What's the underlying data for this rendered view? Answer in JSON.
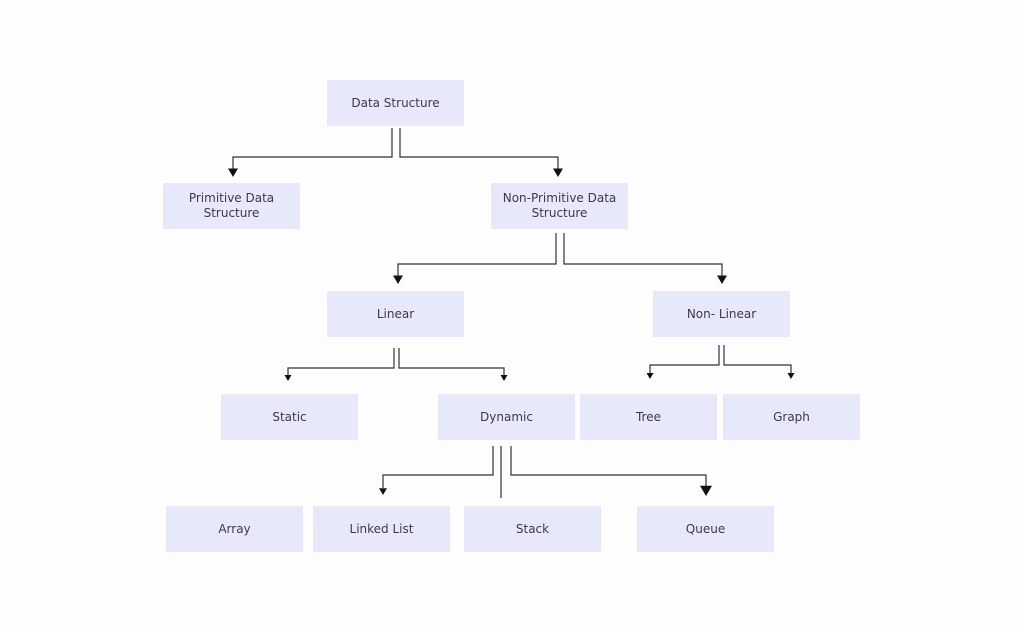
{
  "diagram": {
    "colors": {
      "node_fill": "#e8e8fb",
      "text": "#3a3a4a",
      "connector": "#333333"
    },
    "nodes": {
      "data_structure": "Data Structure",
      "primitive": "Primitive Data Structure",
      "non_primitive": "Non-Primitive Data Structure",
      "linear": "Linear",
      "non_linear": "Non- Linear",
      "static": "Static",
      "dynamic": "Dynamic",
      "tree": "Tree",
      "graph": "Graph",
      "array": "Array",
      "linked_list": "Linked List",
      "stack": "Stack",
      "queue": "Queue"
    },
    "edges": [
      {
        "from": "data_structure",
        "to": "primitive"
      },
      {
        "from": "data_structure",
        "to": "non_primitive"
      },
      {
        "from": "non_primitive",
        "to": "linear"
      },
      {
        "from": "non_primitive",
        "to": "non_linear"
      },
      {
        "from": "linear",
        "to": "static"
      },
      {
        "from": "linear",
        "to": "dynamic"
      },
      {
        "from": "non_linear",
        "to": "tree"
      },
      {
        "from": "non_linear",
        "to": "graph"
      },
      {
        "from": "dynamic",
        "to": "linked_list"
      },
      {
        "from": "dynamic",
        "to": "stack"
      },
      {
        "from": "dynamic",
        "to": "queue"
      }
    ]
  }
}
